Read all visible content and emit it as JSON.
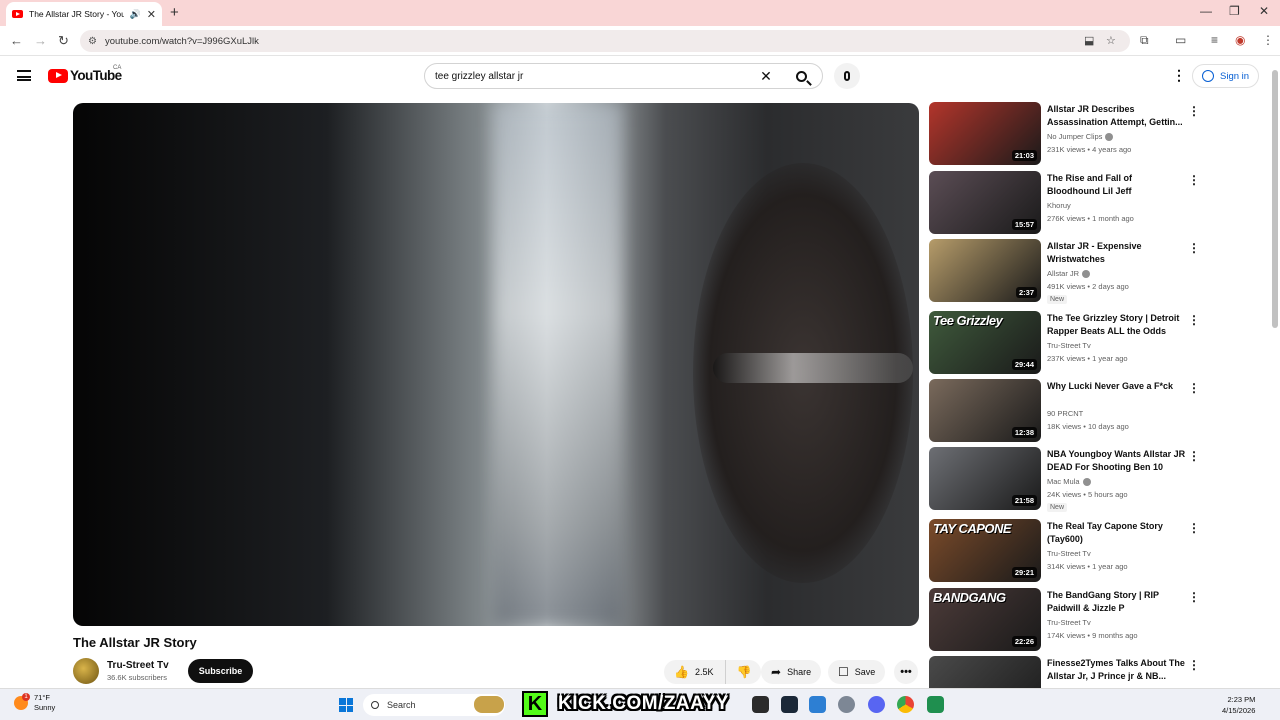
{
  "browser": {
    "tab_title": "The Allstar JR Story - YouTube",
    "new_tab_icon": "plus-icon",
    "url": "youtube.com/watch?v=J996GXuLJlk"
  },
  "header": {
    "logo_text": "YouTube",
    "country_code": "CA",
    "search_query": "tee grizzley allstar jr",
    "sign_in": "Sign in"
  },
  "video": {
    "title": "The Allstar JR Story",
    "channel": "Tru-Street Tv",
    "subscribers": "36.6K subscribers",
    "subscribe_label": "Subscribe",
    "likes": "2.5K",
    "share_label": "Share",
    "save_label": "Save"
  },
  "sidebar": {
    "items": [
      {
        "title": "Allstar JR Describes Assassination Attempt, Gettin...",
        "channel": "No Jumper Clips",
        "verified": true,
        "meta": "231K views • 4 years ago",
        "duration": "21:03",
        "new": false,
        "overlay": "",
        "thumb": "#b3352b"
      },
      {
        "title": "The Rise and Fall of Bloodhound Lil Jeff",
        "channel": "Khoruy",
        "verified": false,
        "meta": "276K views • 1 month ago",
        "duration": "15:57",
        "new": false,
        "overlay": "",
        "thumb": "#5b4d55"
      },
      {
        "title": "Allstar JR - Expensive Wristwatches",
        "channel": "Allstar JR",
        "verified": true,
        "meta": "491K views • 2 days ago",
        "duration": "2:37",
        "new": true,
        "overlay": "",
        "thumb": "#b69c6a"
      },
      {
        "title": "The Tee Grizzley Story | Detroit Rapper Beats ALL the Odds",
        "channel": "Tru-Street Tv",
        "verified": false,
        "meta": "237K views • 1 year ago",
        "duration": "29:44",
        "new": false,
        "overlay": "Tee Grizzley",
        "thumb": "#3f5a3c"
      },
      {
        "title": "Why Lucki Never Gave a F*ck",
        "channel": "90 PRCNT",
        "verified": false,
        "meta": "18K views • 10 days ago",
        "duration": "12:38",
        "new": false,
        "overlay": "",
        "thumb": "#7a6a5c"
      },
      {
        "title": "NBA Youngboy Wants Allstar JR DEAD For Shooting Ben 10",
        "channel": "Mac Mula",
        "verified": true,
        "meta": "24K views • 5 hours ago",
        "duration": "21:58",
        "new": true,
        "overlay": "",
        "thumb": "#6d6f74"
      },
      {
        "title": "The Real Tay Capone Story (Tay600)",
        "channel": "Tru-Street Tv",
        "verified": false,
        "meta": "314K views • 1 year ago",
        "duration": "29:21",
        "new": false,
        "overlay": "TAY CAPONE",
        "thumb": "#7b4b2a"
      },
      {
        "title": "The BandGang Story | RIP Paidwill & Jizzle P",
        "channel": "Tru-Street Tv",
        "verified": false,
        "meta": "174K views • 9 months ago",
        "duration": "22:26",
        "new": false,
        "overlay": "BANDGANG",
        "thumb": "#4c3b39"
      },
      {
        "title": "Finesse2Tymes Talks About The Allstar Jr, J Prince jr & NB...",
        "channel": "",
        "verified": false,
        "meta": "",
        "duration": "",
        "new": false,
        "overlay": "",
        "thumb": "#4a4a4a"
      }
    ]
  },
  "taskbar": {
    "weather_temp": "71°F",
    "weather_desc": "Sunny",
    "weather_badge": "1",
    "search_label": "Search",
    "kick_text": "KICK.COM/ZAAYY",
    "time": "2:23 PM",
    "date": "4/15/2026"
  }
}
